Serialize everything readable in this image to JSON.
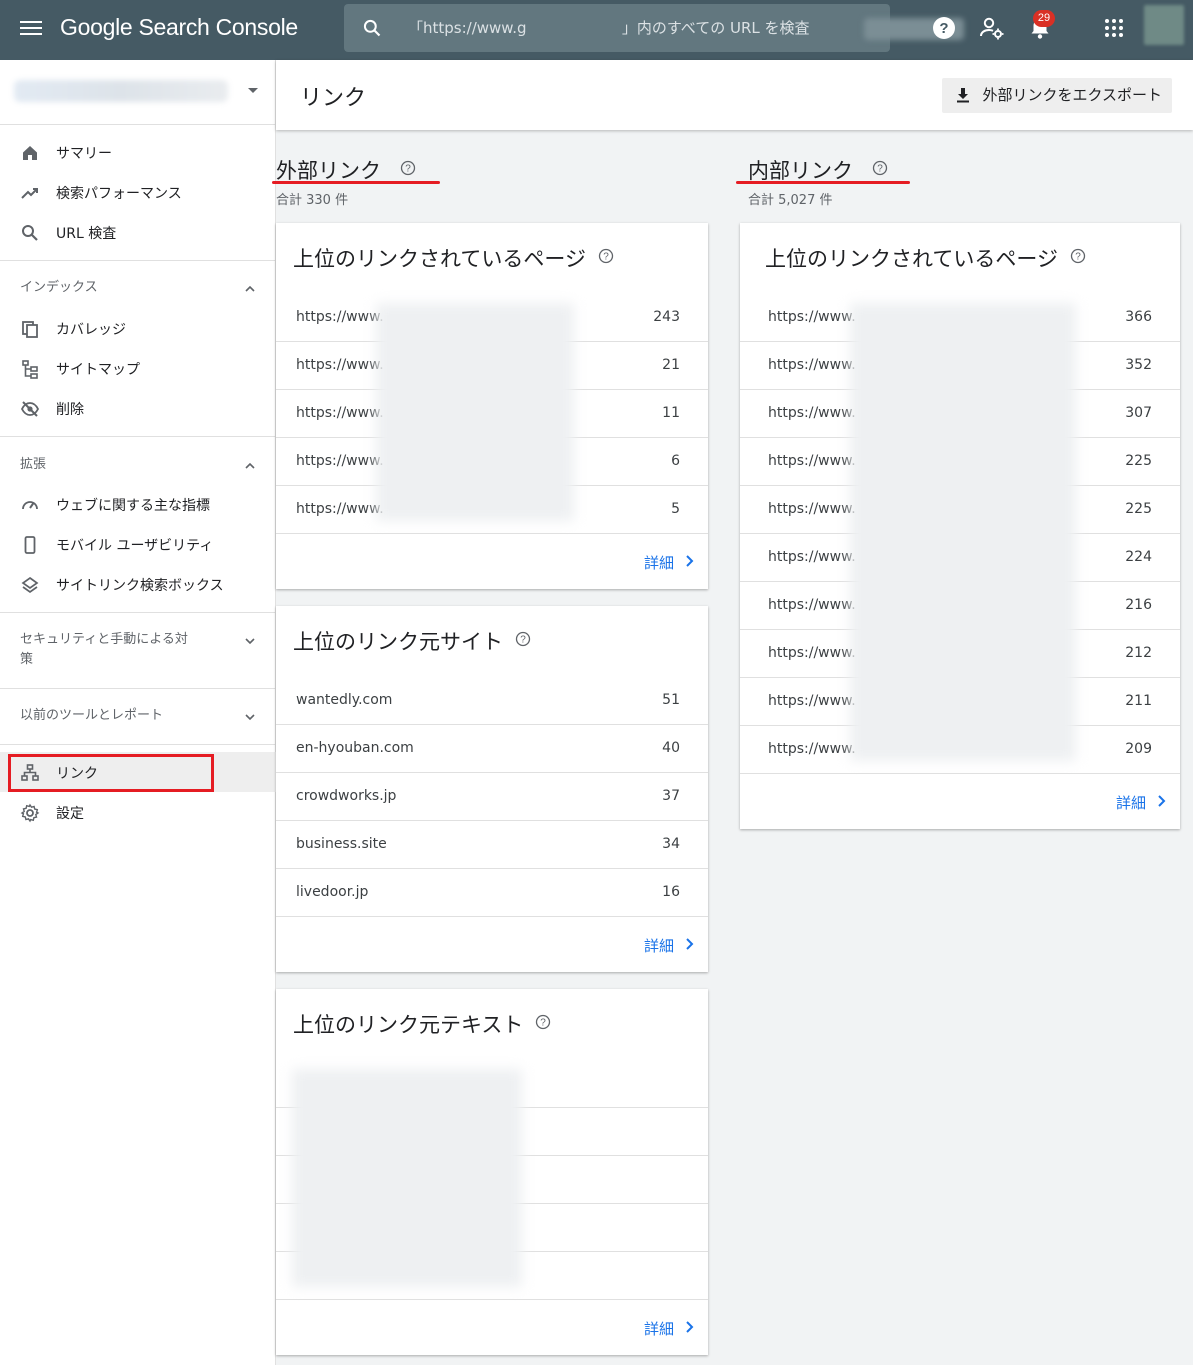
{
  "topbar": {
    "product_name": "Google Search Console",
    "search_placeholder": "「https://www.g                    」内のすべての URL を検査",
    "notification_count": "29"
  },
  "sidebar": {
    "main_items": [
      {
        "label": "サマリー",
        "icon": "home-icon"
      },
      {
        "label": "検索パフォーマンス",
        "icon": "trending-up-icon"
      },
      {
        "label": "URL 検査",
        "icon": "search-icon"
      }
    ],
    "index_section": {
      "label": "インデックス",
      "items": [
        {
          "label": "カバレッジ",
          "icon": "coverage-icon"
        },
        {
          "label": "サイトマップ",
          "icon": "sitemap-icon"
        },
        {
          "label": "削除",
          "icon": "visibility-off-icon"
        }
      ]
    },
    "enhance_section": {
      "label": "拡張",
      "items": [
        {
          "label": "ウェブに関する主な指標",
          "icon": "speed-icon"
        },
        {
          "label": "モバイル ユーザビリティ",
          "icon": "phone-icon"
        },
        {
          "label": "サイトリンク検索ボックス",
          "icon": "layers-icon"
        }
      ]
    },
    "security_section": {
      "label": "セキュリティと手動による対策"
    },
    "legacy_section": {
      "label": "以前のツールとレポート"
    },
    "bottom_items": [
      {
        "label": "リンク",
        "icon": "links-icon"
      },
      {
        "label": "設定",
        "icon": "settings-icon"
      }
    ]
  },
  "main": {
    "title": "リンク",
    "export_label": "外部リンクをエクスポート",
    "external": {
      "heading": "外部リンク",
      "total": "合計 330 件",
      "top_pages": {
        "title": "上位のリンクされているページ",
        "rows": [
          {
            "url": "https://www.",
            "count": "243"
          },
          {
            "url": "https://www.",
            "count": "21"
          },
          {
            "url": "https://www.",
            "count": "11"
          },
          {
            "url": "https://www.",
            "count": "6"
          },
          {
            "url": "https://www.",
            "count": "5"
          }
        ],
        "more": "詳細"
      },
      "top_sites": {
        "title": "上位のリンク元サイト",
        "rows": [
          {
            "url": "wantedly.com",
            "count": "51"
          },
          {
            "url": "en-hyouban.com",
            "count": "40"
          },
          {
            "url": "crowdworks.jp",
            "count": "37"
          },
          {
            "url": "business.site",
            "count": "34"
          },
          {
            "url": "livedoor.jp",
            "count": "16"
          }
        ],
        "more": "詳細"
      },
      "top_texts": {
        "title": "上位のリンク元テキスト",
        "more": "詳細"
      }
    },
    "internal": {
      "heading": "内部リンク",
      "total": "合計 5,027 件",
      "top_pages": {
        "title": "上位のリンクされているページ",
        "rows": [
          {
            "url": "https://www.",
            "count": "366"
          },
          {
            "url": "https://www.",
            "count": "352"
          },
          {
            "url": "https://www.",
            "count": "307"
          },
          {
            "url": "https://www.",
            "count": "225"
          },
          {
            "url": "https://www.",
            "count": "225"
          },
          {
            "url": "https://www.",
            "count": "224"
          },
          {
            "url": "https://www.",
            "count": "216"
          },
          {
            "url": "https://www.",
            "count": "212"
          },
          {
            "url": "https://www.",
            "count": "211"
          },
          {
            "url": "https://www.",
            "count": "209"
          }
        ],
        "more": "詳細"
      }
    }
  },
  "colors": {
    "topbar": "#455a64",
    "accent_link": "#1a73e8",
    "highlight_red": "#e51c23",
    "badge": "#d93025"
  }
}
